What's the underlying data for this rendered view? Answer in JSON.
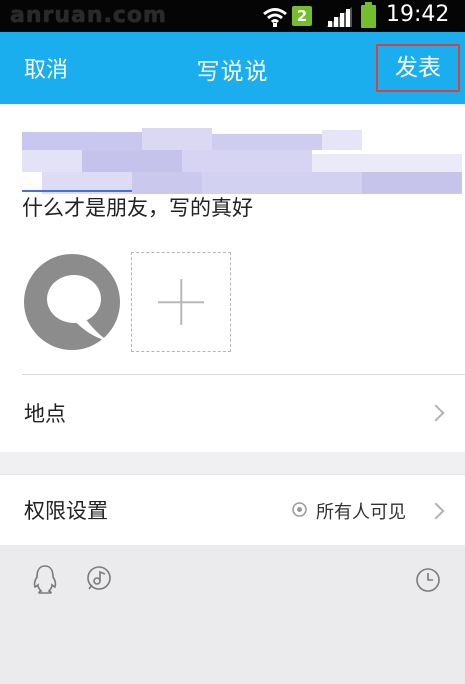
{
  "status_bar": {
    "watermark": "anruan.com",
    "sim_number": "2",
    "time": "19:42",
    "battery_color": "#74bd2c"
  },
  "nav": {
    "cancel_label": "取消",
    "title": "写说说",
    "publish_label": "发表",
    "background": "#1aaeee",
    "highlight_color": "#d8413d"
  },
  "post": {
    "text": "什么才是朋友，写的真好"
  },
  "location": {
    "label": "地点"
  },
  "permission": {
    "label": "权限设置",
    "value": "所有人可见"
  },
  "toolbar": {
    "icons": [
      "qq-penguin-icon",
      "music-icon",
      "clock-icon"
    ]
  }
}
